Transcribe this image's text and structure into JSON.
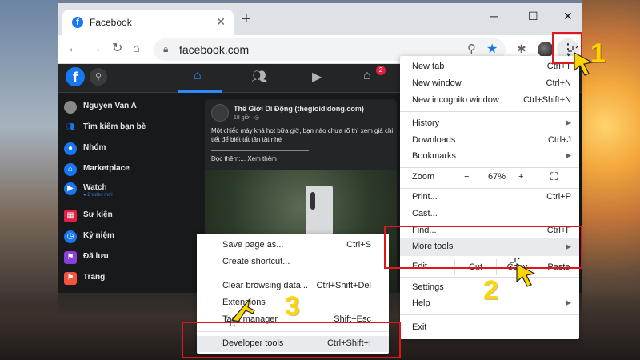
{
  "browser": {
    "tab_title": "Facebook",
    "tab_close": "✕",
    "new_tab": "+",
    "url": "facebook.com",
    "window_controls": [
      "─",
      "☐",
      "✕"
    ]
  },
  "facebook": {
    "logo": "f",
    "notification_count": "2",
    "sidebar": [
      {
        "label": "Nguyen Van A",
        "color": "#888888",
        "icon": "user-avatar"
      },
      {
        "label": "Tìm kiếm bạn bè",
        "color": "#1877f2",
        "icon": "friends-icon"
      },
      {
        "label": "Nhóm",
        "color": "#1877f2",
        "icon": "groups-icon"
      },
      {
        "label": "Marketplace",
        "color": "#1877f2",
        "icon": "marketplace-icon"
      },
      {
        "label": "Watch",
        "color": "#1877f2",
        "icon": "watch-icon",
        "sub": "● 2 video mới"
      },
      {
        "label": "Sự kiện",
        "color": "#e41e3f",
        "icon": "events-icon"
      },
      {
        "label": "Kỷ niệm",
        "color": "#1877f2",
        "icon": "memories-icon"
      },
      {
        "label": "Đã lưu",
        "color": "#8b3fd9",
        "icon": "saved-icon"
      },
      {
        "label": "Trang",
        "color": "#f5533d",
        "icon": "pages-icon"
      }
    ],
    "post": {
      "author": "Thế Giới Di Động (thegioididong.com)",
      "time": "18 giờ · ◎",
      "text": "Một chiếc máy khá hot bữa giờ, bạn nào chưa rõ thì xem giá chi tiết để biết tất tần tật nhé",
      "more": "Đọc thêm:... Xem thêm"
    }
  },
  "menu": {
    "new_tab": {
      "label": "New tab",
      "shortcut": "Ctrl+T"
    },
    "new_window": {
      "label": "New window",
      "shortcut": "Ctrl+N"
    },
    "new_incognito": {
      "label": "New incognito window",
      "shortcut": "Ctrl+Shift+N"
    },
    "history": {
      "label": "History"
    },
    "downloads": {
      "label": "Downloads",
      "shortcut": "Ctrl+J"
    },
    "bookmarks": {
      "label": "Bookmarks"
    },
    "zoom": {
      "label": "Zoom",
      "minus": "−",
      "value": "67%",
      "plus": "+"
    },
    "print": {
      "label": "Print...",
      "shortcut": "Ctrl+P"
    },
    "cast": {
      "label": "Cast..."
    },
    "find": {
      "label": "Find...",
      "shortcut": "Ctrl+F"
    },
    "more_tools": {
      "label": "More tools"
    },
    "edit": {
      "label": "Edit",
      "cut": "Cut",
      "copy": "Copy",
      "paste": "Paste"
    },
    "settings": {
      "label": "Settings"
    },
    "help": {
      "label": "Help"
    },
    "exit": {
      "label": "Exit"
    }
  },
  "submenu": {
    "save_page": {
      "label": "Save page as...",
      "shortcut": "Ctrl+S"
    },
    "create_shortcut": {
      "label": "Create shortcut..."
    },
    "clear_browsing": {
      "label": "Clear browsing data...",
      "shortcut": "Ctrl+Shift+Del"
    },
    "extensions": {
      "label": "Extensions"
    },
    "task_manager": {
      "label": "Task manager",
      "shortcut": "Shift+Esc"
    },
    "developer_tools": {
      "label": "Developer tools",
      "shortcut": "Ctrl+Shift+I"
    }
  },
  "annotations": {
    "step1": "1",
    "step2": "2",
    "step3": "3",
    "highlight_color": "#e0161f",
    "step_color": "#ffd500"
  }
}
